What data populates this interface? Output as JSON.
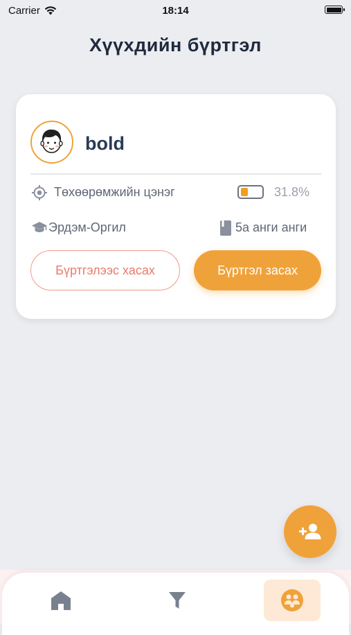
{
  "status_bar": {
    "carrier": "Carrier",
    "time": "18:14"
  },
  "header": {
    "title": "Хүүхдийн бүртгэл"
  },
  "child_card": {
    "name": "bold",
    "avatar_icon": "boy-face-icon",
    "device_label": "Төхөөрөмжийн цэнэг",
    "charge_text": "31.8%",
    "charge_level_percent": 31.8,
    "school": "Эрдэм-Оргил",
    "class": "5а анги анги",
    "remove_button": "Бүртгэлээс хасах",
    "edit_button": "Бүртгэл засах"
  },
  "fab": {
    "icon": "add-person-icon"
  },
  "tab_bar": {
    "tabs": [
      {
        "icon": "home-icon",
        "active": false
      },
      {
        "icon": "filter-icon",
        "active": false
      },
      {
        "icon": "children-icon",
        "active": true
      }
    ]
  },
  "colors": {
    "accent": "#f0a23a",
    "danger": "#ea7b6a",
    "title": "#1f2a3c",
    "background": "#ecedf1",
    "active_tab_bg": "#fde9d6"
  }
}
